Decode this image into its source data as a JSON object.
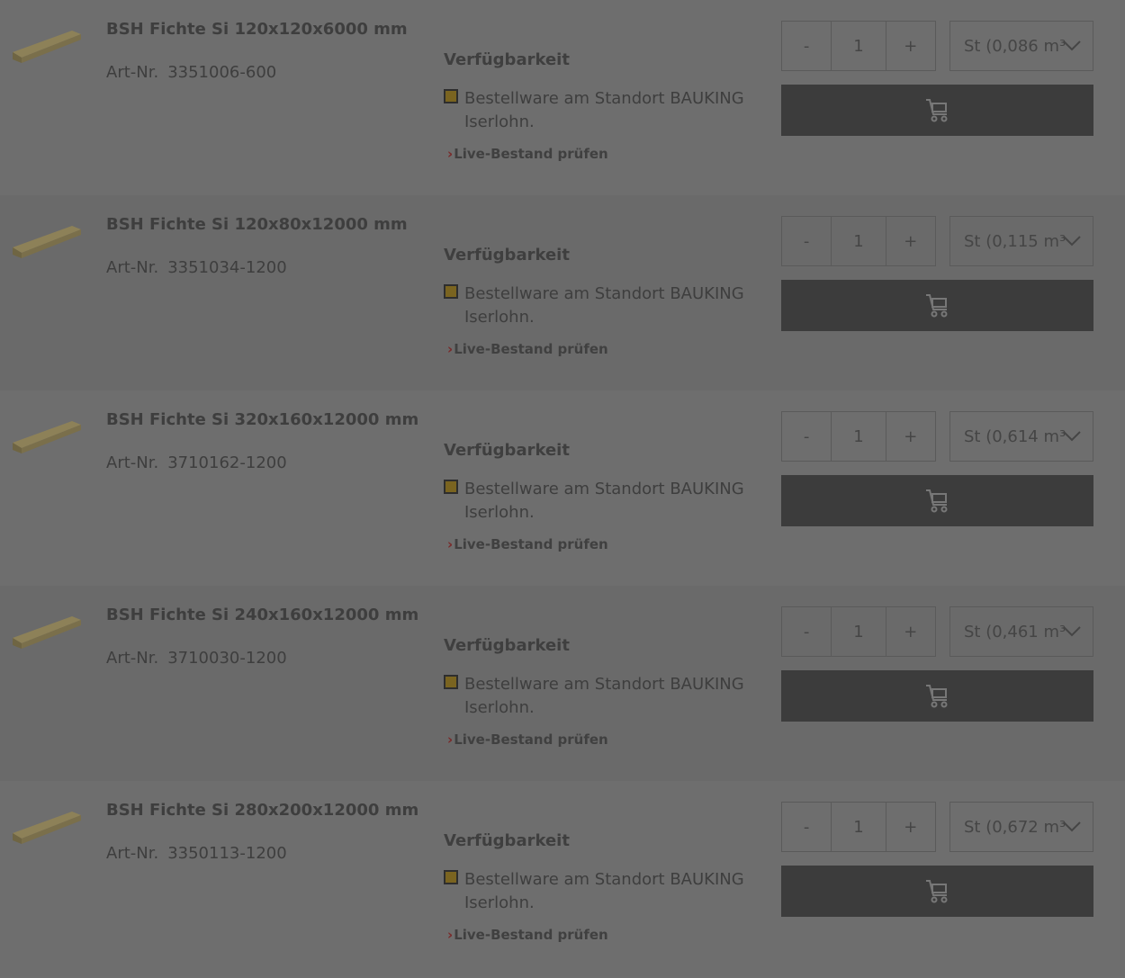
{
  "products": [
    {
      "title": "BSH Fichte Si 120x120x6000 mm",
      "art_label": "Art-Nr.",
      "art_nr": "3351006-600",
      "availability_heading": "Verfügbarkeit",
      "availability_text": "Bestellware am Standort BAUKING Iserlohn.",
      "live_link": "Live-Bestand prüfen",
      "qty_minus": "-",
      "quantity": "1",
      "qty_plus": "+",
      "unit": "St (0,086 m³"
    },
    {
      "title": "BSH Fichte Si 120x80x12000 mm",
      "art_label": "Art-Nr.",
      "art_nr": "3351034-1200",
      "availability_heading": "Verfügbarkeit",
      "availability_text": "Bestellware am Standort BAUKING Iserlohn.",
      "live_link": "Live-Bestand prüfen",
      "qty_minus": "-",
      "quantity": "1",
      "qty_plus": "+",
      "unit": "St (0,115 m³"
    },
    {
      "title": "BSH Fichte Si 320x160x12000 mm",
      "art_label": "Art-Nr.",
      "art_nr": "3710162-1200",
      "availability_heading": "Verfügbarkeit",
      "availability_text": "Bestellware am Standort BAUKING Iserlohn.",
      "live_link": "Live-Bestand prüfen",
      "qty_minus": "-",
      "quantity": "1",
      "qty_plus": "+",
      "unit": "St (0,614 m³"
    },
    {
      "title": "BSH Fichte Si 240x160x12000 mm",
      "art_label": "Art-Nr.",
      "art_nr": "3710030-1200",
      "availability_heading": "Verfügbarkeit",
      "availability_text": "Bestellware am Standort BAUKING Iserlohn.",
      "live_link": "Live-Bestand prüfen",
      "qty_minus": "-",
      "quantity": "1",
      "qty_plus": "+",
      "unit": "St (0,461 m³"
    },
    {
      "title": "BSH Fichte Si 280x200x12000 mm",
      "art_label": "Art-Nr.",
      "art_nr": "3350113-1200",
      "availability_heading": "Verfügbarkeit",
      "availability_text": "Bestellware am Standort BAUKING Iserlohn.",
      "live_link": "Live-Bestand prüfen",
      "qty_minus": "-",
      "quantity": "1",
      "qty_plus": "+",
      "unit": "St (0,672 m³"
    }
  ],
  "icons": {
    "product_image": "wooden-beam-icon",
    "availability": "availability-status-icon",
    "link_chevron": "chevron-right-icon",
    "select_chevron": "chevron-down-icon",
    "cart": "add-to-cart-icon"
  },
  "colors": {
    "overlay_background": "#6f6f6f",
    "cart_button": "#3c3c3c",
    "availability_square": "#7a6420",
    "link_chevron": "#7a2a2a",
    "wood": "#8a7d55"
  }
}
